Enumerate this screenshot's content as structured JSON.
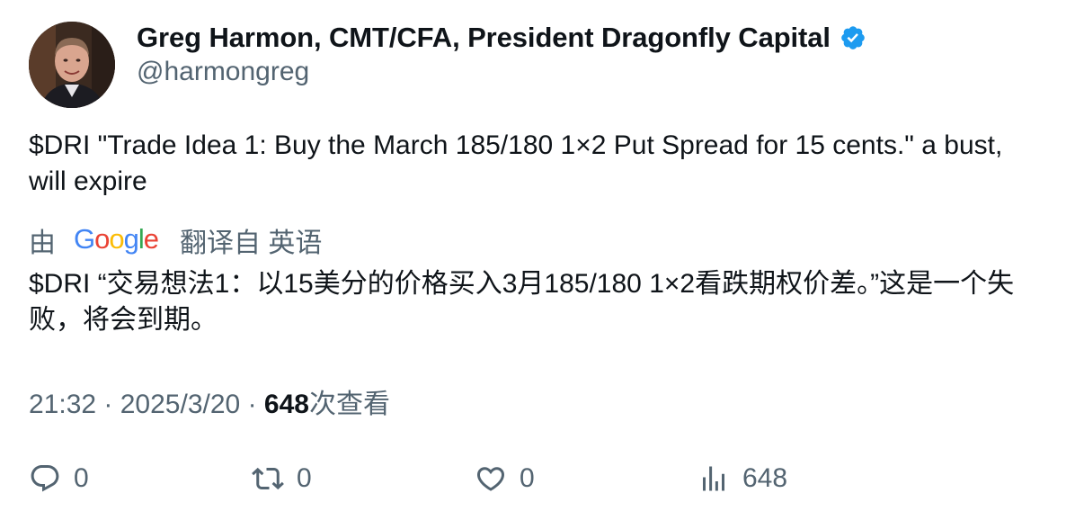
{
  "author": {
    "display_name": "Greg Harmon, CMT/CFA, President Dragonfly Capital",
    "handle": "@harmongreg"
  },
  "tweet": {
    "text": "$DRI \"Trade Idea 1: Buy the March 185/180 1×2 Put Spread for 15 cents.\" a bust, will expire"
  },
  "translation": {
    "prefix": "由",
    "provider_icon": "google-logo",
    "suffix": "翻译自 英语",
    "text": "$DRI “交易想法1：以15美分的价格买入3月185/180 1×2看跌期权价差。”这是一个失败，将会到期。"
  },
  "meta": {
    "time": "21:32",
    "separator": "·",
    "date": "2025/3/20",
    "views": "648",
    "views_label": "次查看"
  },
  "actions": {
    "replies": "0",
    "retweets": "0",
    "likes": "0",
    "views": "648"
  },
  "colors": {
    "text_primary": "#0f1419",
    "text_secondary": "#536471",
    "verified_blue": "#1d9bf0"
  }
}
